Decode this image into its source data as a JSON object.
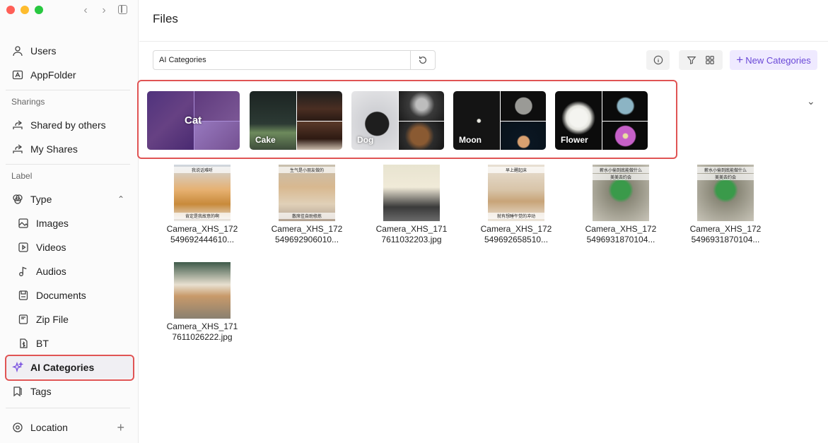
{
  "window": {
    "title": "Files"
  },
  "sidebar": {
    "top_items": [
      {
        "label": "Users",
        "icon": "user-icon"
      },
      {
        "label": "AppFolder",
        "icon": "app-folder-icon"
      }
    ],
    "sharings_label": "Sharings",
    "sharing_items": [
      {
        "label": "Shared by others",
        "icon": "share-icon"
      },
      {
        "label": "My Shares",
        "icon": "share-icon"
      }
    ],
    "label_section": "Label",
    "type_label": "Type",
    "type_items": [
      {
        "label": "Images",
        "icon": "image-icon"
      },
      {
        "label": "Videos",
        "icon": "video-icon"
      },
      {
        "label": "Audios",
        "icon": "music-icon"
      },
      {
        "label": "Documents",
        "icon": "document-icon"
      },
      {
        "label": "Zip File",
        "icon": "zip-icon"
      },
      {
        "label": "BT",
        "icon": "bt-file-icon"
      }
    ],
    "ai_categories": "AI Categories",
    "tags": "Tags",
    "location": "Location"
  },
  "toolbar": {
    "search_value": "AI Categories",
    "new_categories": "New Categories"
  },
  "categories": [
    {
      "label": "Cat"
    },
    {
      "label": "Cake"
    },
    {
      "label": "Dog"
    },
    {
      "label": "Moon"
    },
    {
      "label": "Flower"
    }
  ],
  "files": [
    {
      "name1": "Camera_XHS_172",
      "name2": "549692444610...",
      "caption_top": "我说话难听",
      "caption_bottom": "肯定是我故意的啊"
    },
    {
      "name1": "Camera_XHS_172",
      "name2": "549692906010...",
      "caption_top": "生气是小朋友做的",
      "caption_bottom": "散席佳自助修炼"
    },
    {
      "name1": "Camera_XHS_171",
      "name2": "7611032203.jpg",
      "caption_top": "",
      "caption_bottom": ""
    },
    {
      "name1": "Camera_XHS_172",
      "name2": "549692658510...",
      "caption_top": "早上醒起床",
      "caption_bottom": "就有想睡午觉的冲动"
    },
    {
      "name1": "Camera_XHS_172",
      "name2": "5496931870104...",
      "caption_top": "薪水小偷到底能做什么",
      "caption_bottom": "美美去约会"
    },
    {
      "name1": "Camera_XHS_172",
      "name2": "5496931870104...",
      "caption_top": "薪水小偷到底能做什么",
      "caption_bottom": "美美去约会"
    },
    {
      "name1": "Camera_XHS_171",
      "name2": "7611026222.jpg",
      "caption_top": "",
      "caption_bottom": ""
    }
  ],
  "colors": {
    "accent": "#7a52e0",
    "highlight": "#e05454",
    "new_button_bg": "#efeaff"
  }
}
